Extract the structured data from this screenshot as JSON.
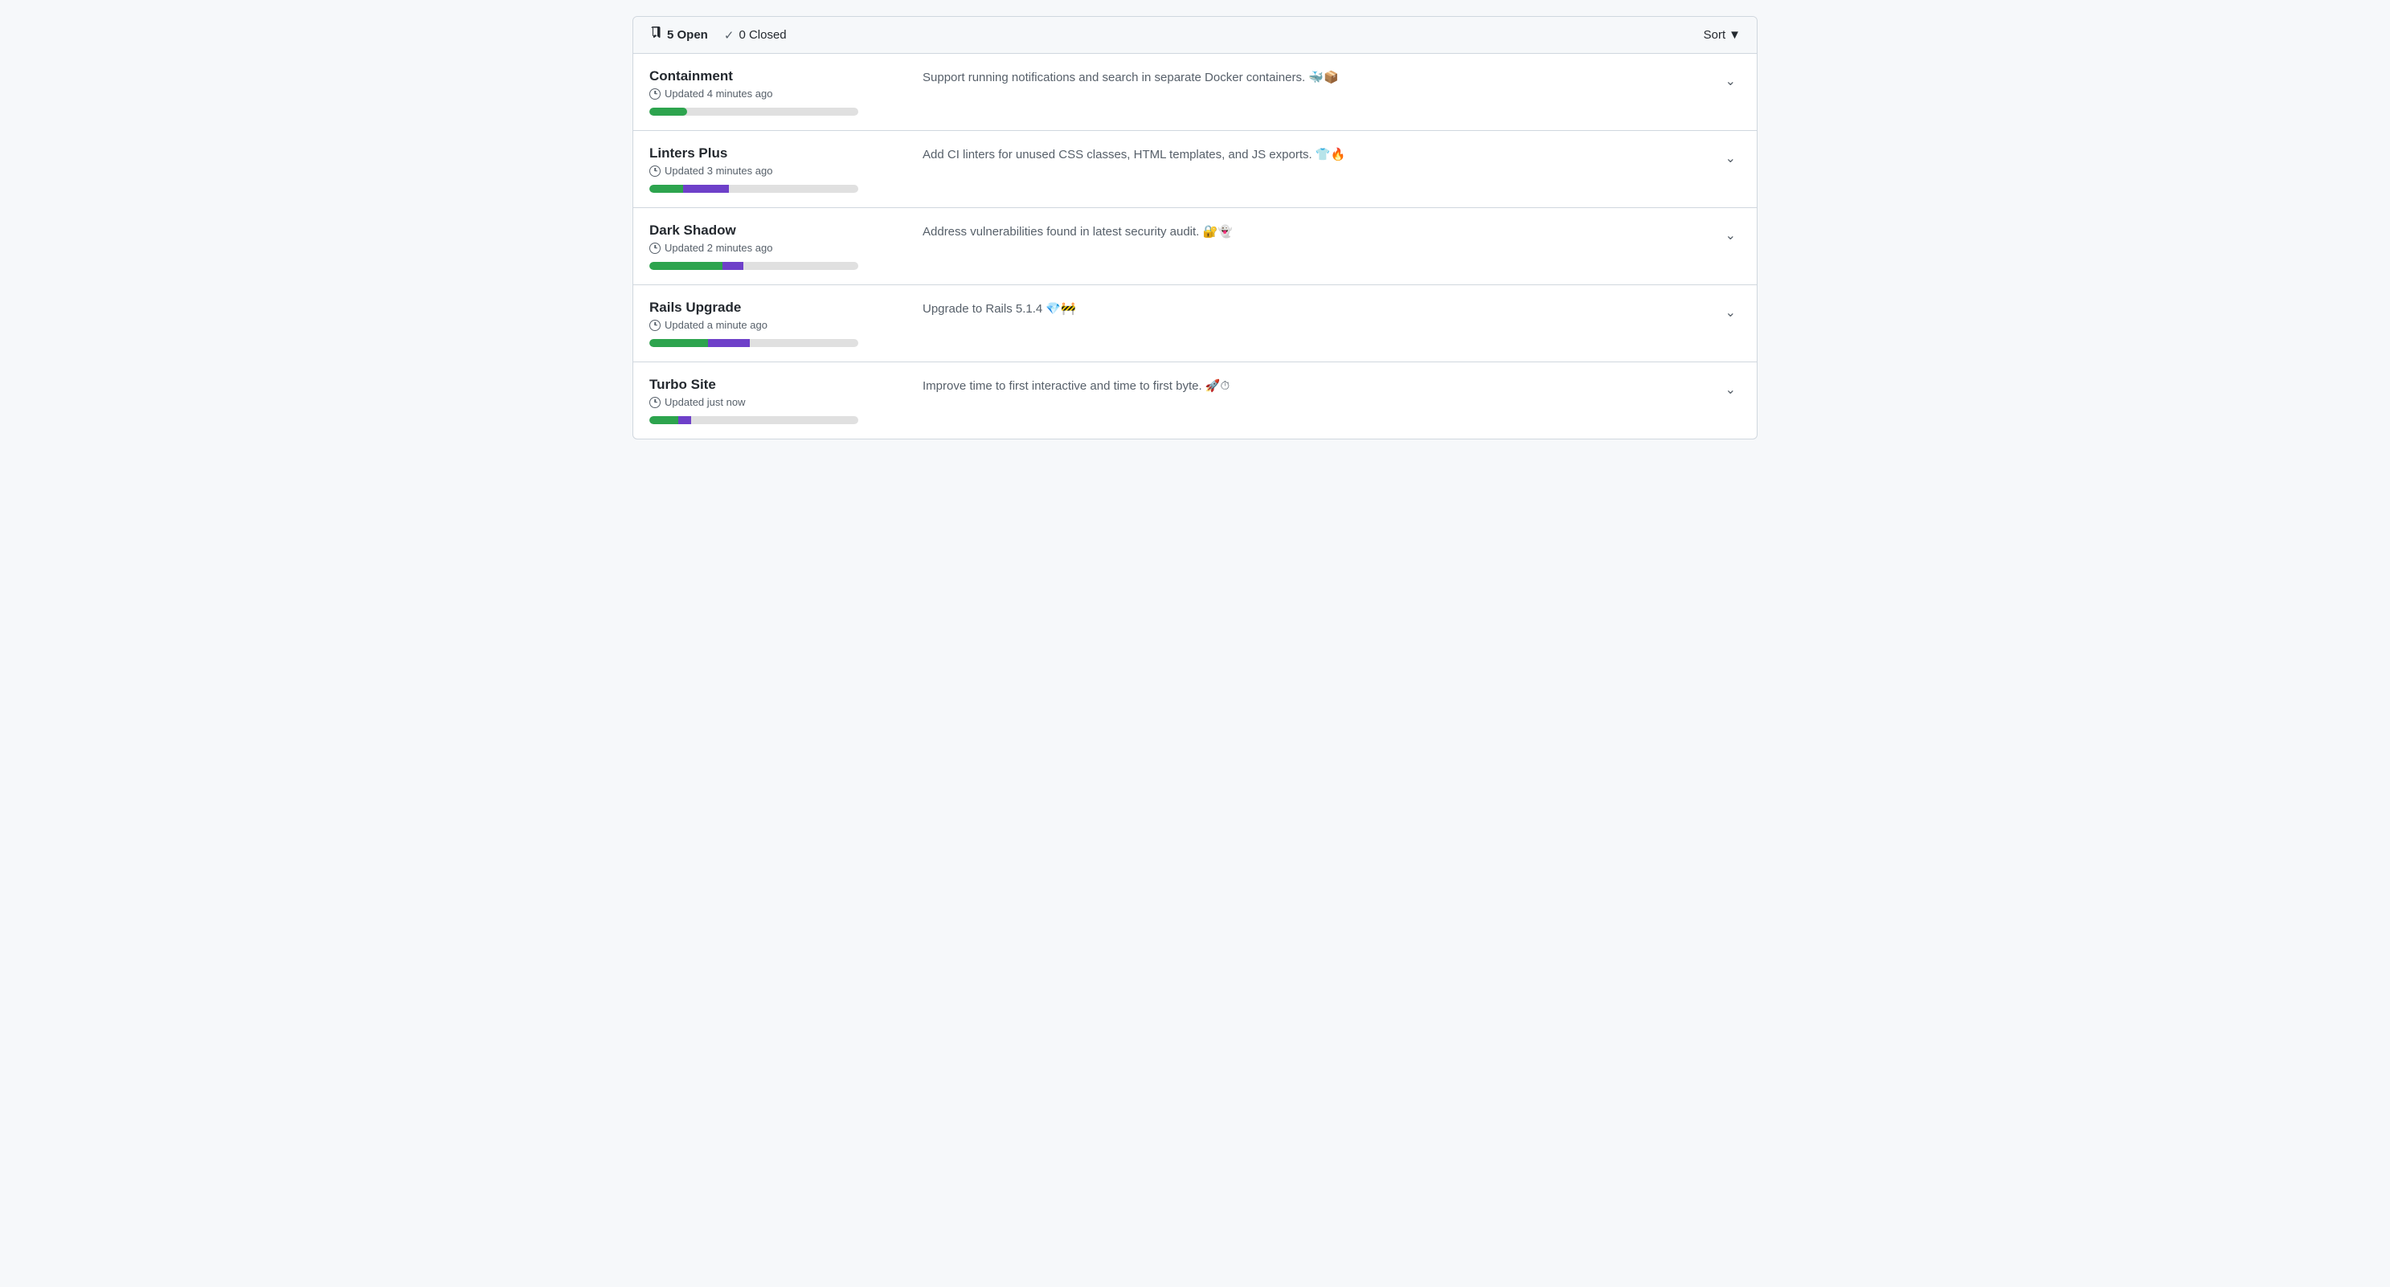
{
  "header": {
    "open_count": "5 Open",
    "closed_count": "0 Closed",
    "sort_label": "Sort",
    "open_icon": "milestone-icon",
    "check_icon": "check-icon"
  },
  "milestones": [
    {
      "title": "Containment",
      "updated": "Updated 4 minutes ago",
      "description": "Support running notifications and search in separate Docker containers. 🐳📦",
      "progress_green": 18,
      "progress_purple": 0
    },
    {
      "title": "Linters Plus",
      "updated": "Updated 3 minutes ago",
      "description": "Add CI linters for unused CSS classes, HTML templates, and JS exports. 👕🔥",
      "progress_green": 16,
      "progress_purple": 22
    },
    {
      "title": "Dark Shadow",
      "updated": "Updated 2 minutes ago",
      "description": "Address vulnerabilities found in latest security audit. 🔐👻",
      "progress_green": 35,
      "progress_purple": 10
    },
    {
      "title": "Rails Upgrade",
      "updated": "Updated a minute ago",
      "description": "Upgrade to Rails 5.1.4 💎🚧",
      "progress_green": 28,
      "progress_purple": 20
    },
    {
      "title": "Turbo Site",
      "updated": "Updated just now",
      "description": "Improve time to first interactive and time to first byte. 🚀⏱",
      "progress_green": 14,
      "progress_purple": 6
    }
  ]
}
